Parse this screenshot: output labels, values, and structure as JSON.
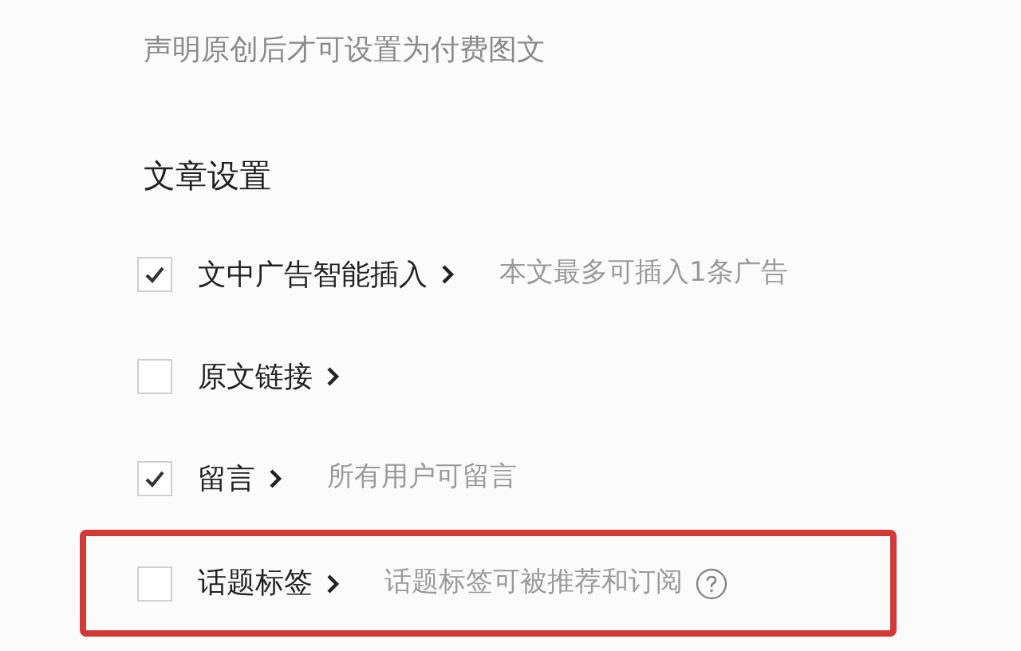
{
  "note": "声明原创后才可设置为付费图文",
  "section_title": "文章设置",
  "options": [
    {
      "label": "文中广告智能插入",
      "checked": true,
      "description": "本文最多可插入1条广告",
      "help": false,
      "highlighted": false
    },
    {
      "label": "原文链接",
      "checked": false,
      "help": false,
      "highlighted": false
    },
    {
      "label": "留言",
      "checked": true,
      "description": "所有用户可留言",
      "help": false,
      "highlighted": false
    },
    {
      "label": "话题标签",
      "checked": false,
      "description": "话题标签可被推荐和订阅",
      "help": true,
      "highlighted": true
    }
  ]
}
